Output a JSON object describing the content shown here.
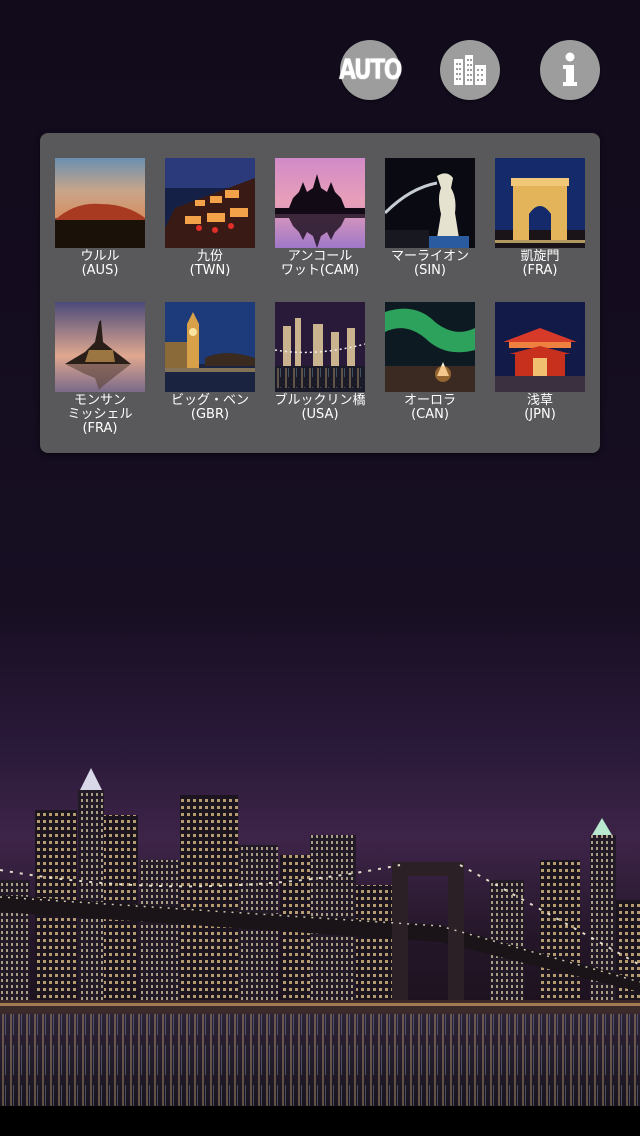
{
  "toolbar": {
    "auto_label": "AUTO",
    "city_icon": "city-buildings-icon",
    "info_icon": "info-icon"
  },
  "colors": {
    "button_bg": "#9d9d9d",
    "panel_bg": "#5f5f5f",
    "label_text": "#ffffff"
  },
  "locations": [
    {
      "label": "ウルル\n(AUS)",
      "icon": "uluru-thumbnail"
    },
    {
      "label": "九份\n(TWN)",
      "icon": "jiufen-thumbnail"
    },
    {
      "label": "アンコール\nワット(CAM)",
      "icon": "angkor-wat-thumbnail"
    },
    {
      "label": "マーライオン\n(SIN)",
      "icon": "merlion-thumbnail"
    },
    {
      "label": "凱旋門\n(FRA)",
      "icon": "arc-de-triomphe-thumbnail"
    },
    {
      "label": "モンサン\nミッシェル\n(FRA)",
      "icon": "mont-saint-michel-thumbnail"
    },
    {
      "label": "ビッグ・ベン\n(GBR)",
      "icon": "big-ben-thumbnail"
    },
    {
      "label": "ブルックリン橋\n(USA)",
      "icon": "brooklyn-bridge-thumbnail"
    },
    {
      "label": "オーロラ\n(CAN)",
      "icon": "aurora-thumbnail"
    },
    {
      "label": "浅草\n(JPN)",
      "icon": "asakusa-thumbnail"
    }
  ]
}
